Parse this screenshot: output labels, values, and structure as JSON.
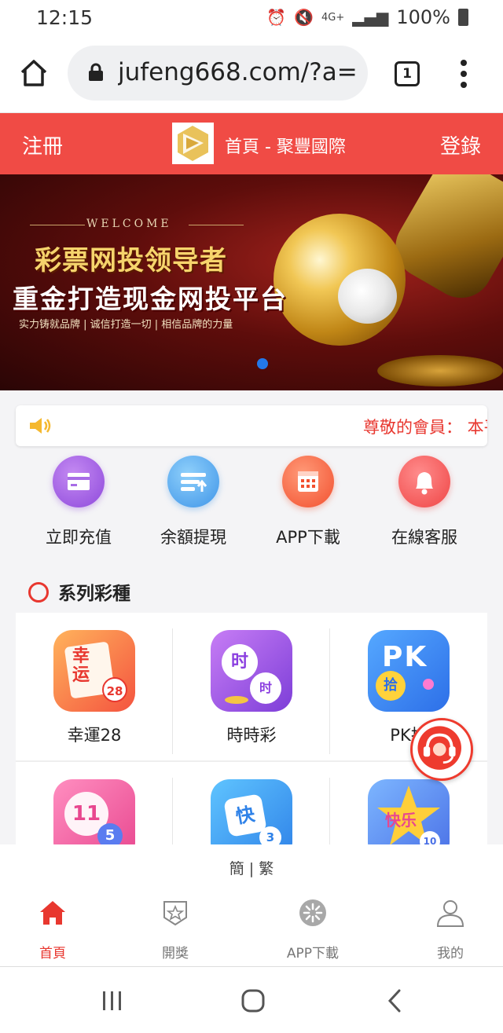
{
  "status_bar": {
    "time": "12:15",
    "network": "4G+",
    "battery": "100%"
  },
  "browser": {
    "url": "jufeng668.com/?a=",
    "tab_count": "1"
  },
  "site_header": {
    "register": "注冊",
    "title": "首頁 - 聚豐國際",
    "login": "登錄"
  },
  "banner": {
    "welcome": "WELCOME",
    "headline": "彩票网投领导者",
    "subheadline": "重金打造现金网投平台",
    "tagline": "实力铸就品牌 | 诚信打造一切 | 相信品牌的力量"
  },
  "notice": {
    "text": "尊敬的會員： 本平"
  },
  "quick_actions": [
    {
      "label": "立即充值",
      "icon": "card-icon",
      "color": "#9b5de5"
    },
    {
      "label": "余額提現",
      "icon": "withdraw-icon",
      "color": "#4fa6f0"
    },
    {
      "label": "APP下載",
      "icon": "calendar-icon",
      "color": "#f7644a"
    },
    {
      "label": "在線客服",
      "icon": "bell-icon",
      "color": "#f45a5a"
    }
  ],
  "series": {
    "title": "系列彩種",
    "games": [
      {
        "label": "幸運28",
        "icon_text": "幸运",
        "badge": "28"
      },
      {
        "label": "時時彩",
        "icon_text": "时",
        "badge": "时"
      },
      {
        "label": "PK拾",
        "icon_text": "PK",
        "badge": "拾"
      },
      {
        "label": "",
        "icon_text": "11",
        "badge": "5"
      },
      {
        "label": "",
        "icon_text": "快",
        "badge": "3"
      },
      {
        "label": "",
        "icon_text": "快乐",
        "badge": "10"
      }
    ]
  },
  "language": {
    "simplified": "簡",
    "separator": " | ",
    "traditional": "繁"
  },
  "bottom_nav": [
    {
      "label": "首頁",
      "active": true
    },
    {
      "label": "開獎",
      "active": false
    },
    {
      "label": "APP下載",
      "active": false
    },
    {
      "label": "我的",
      "active": false
    }
  ],
  "colors": {
    "brand_red": "#f04b45",
    "accent_red": "#e8372f",
    "link_blue": "#2378ea"
  }
}
